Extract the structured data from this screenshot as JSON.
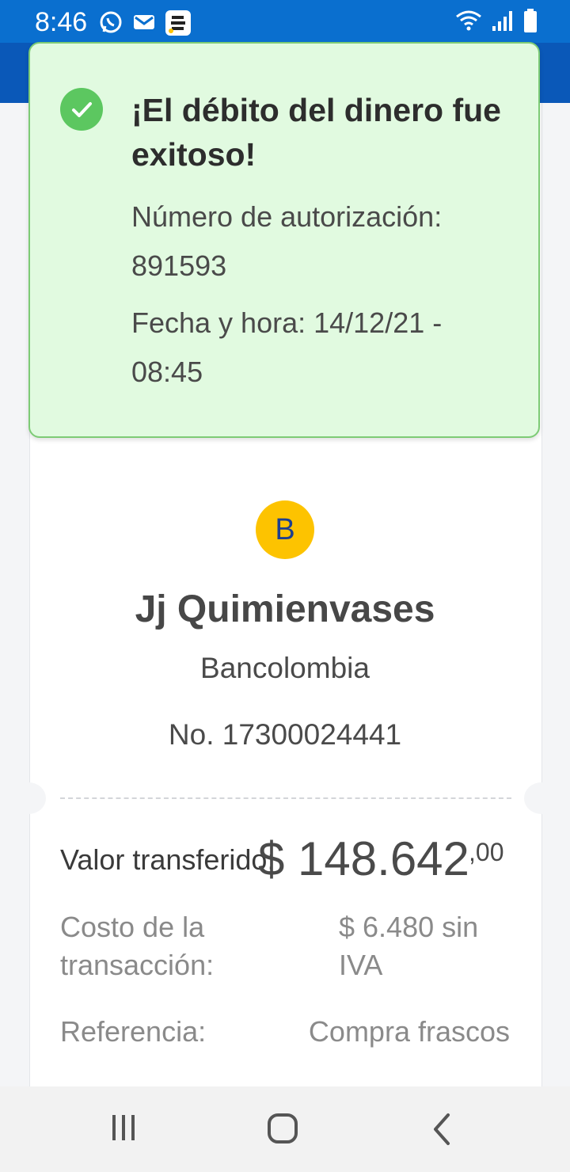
{
  "status_bar": {
    "time": "8:46",
    "left_icons": [
      "whatsapp-icon",
      "mail-icon",
      "bancolombia-app-icon"
    ],
    "right_icons": [
      "wifi-icon",
      "signal-icon",
      "battery-icon"
    ]
  },
  "toast": {
    "title": "¡El débito del dinero fue exitoso!",
    "auth_label": "Número de autorización:",
    "auth_number": "891593",
    "datetime_line1": "Fecha y hora: 14/12/21 -",
    "datetime_line2": "08:45",
    "icon": "check-circle-icon",
    "accent_color": "#5cc760",
    "background_color": "#e1fae0"
  },
  "recipient": {
    "bank_badge": "B",
    "name": "Jj Quimienvases",
    "bank": "Bancolombia",
    "account": "No. 17300024441"
  },
  "details": {
    "amount_label": "Valor transferido:",
    "amount_value": "$ 148.642",
    "amount_cents": ",00",
    "cost_label_line1": "Costo de la",
    "cost_label_line2": "transacción:",
    "cost_value_line1": "$ 6.480 sin",
    "cost_value_line2": "IVA",
    "reference_label": "Referencia:",
    "reference_value": "Compra frascos"
  },
  "nav_bar": {
    "buttons": [
      "recent-apps-icon",
      "home-icon",
      "back-icon"
    ]
  },
  "colors": {
    "status_bar": "#0a6fcf",
    "header": "#0a58b8",
    "bank_badge": "#fdc300"
  }
}
